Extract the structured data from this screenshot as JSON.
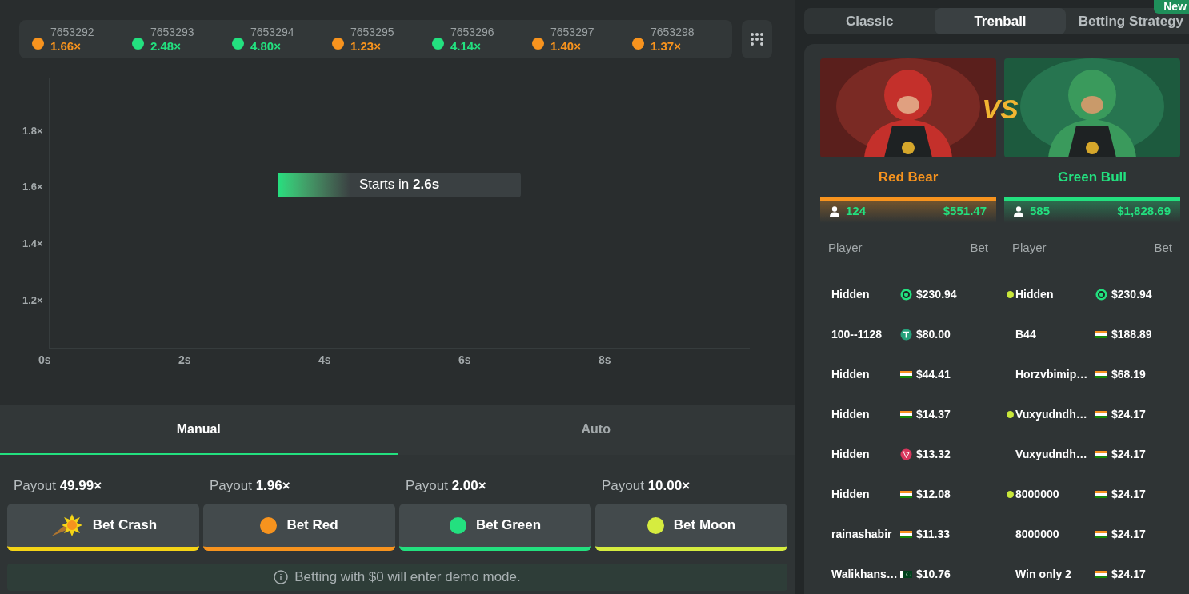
{
  "history": [
    {
      "id": "7653292",
      "multiplier": "1.66×",
      "color": "#f7931e"
    },
    {
      "id": "7653293",
      "multiplier": "2.48×",
      "color": "#23e07f"
    },
    {
      "id": "7653294",
      "multiplier": "4.80×",
      "color": "#23e07f"
    },
    {
      "id": "7653295",
      "multiplier": "1.23×",
      "color": "#f7931e"
    },
    {
      "id": "7653296",
      "multiplier": "4.14×",
      "color": "#23e07f"
    },
    {
      "id": "7653297",
      "multiplier": "1.40×",
      "color": "#f7931e"
    },
    {
      "id": "7653298",
      "multiplier": "1.37×",
      "color": "#f7931e"
    }
  ],
  "chart": {
    "y_ticks": [
      "1.8×",
      "1.6×",
      "1.4×",
      "1.2×"
    ],
    "x_ticks": [
      "0s",
      "2s",
      "4s",
      "6s",
      "8s"
    ],
    "countdown": {
      "text": "Starts in **2.6s**",
      "level": 0.3
    }
  },
  "bet_tabs": [
    {
      "label": "Manual",
      "selected": true
    },
    {
      "label": "Auto",
      "selected": false
    }
  ],
  "bets": [
    {
      "kind": "crash",
      "payout_label": "Payout",
      "payout": "49.99×",
      "label": "Bet Crash",
      "color": "#f5d416"
    },
    {
      "kind": "dot",
      "payout_label": "Payout",
      "payout": "1.96×",
      "label": "Bet Red",
      "color": "#f7931e"
    },
    {
      "kind": "dot",
      "payout_label": "Payout",
      "payout": "2.00×",
      "label": "Bet Green",
      "color": "#23e07f"
    },
    {
      "kind": "dot",
      "payout_label": "Payout",
      "payout": "10.00×",
      "label": "Bet Moon",
      "color": "#d6ec3f"
    }
  ],
  "notice": "Betting with $0 will enter demo mode.",
  "mode_tabs": [
    {
      "label": "Classic",
      "selected": false
    },
    {
      "label": "Trenball",
      "selected": true
    },
    {
      "label": "Betting Strategy",
      "selected": false,
      "badge": "New"
    }
  ],
  "vs": "VS",
  "sides": [
    {
      "name": "Red Bear",
      "color": "#f7931e",
      "players": "124",
      "total": "$551.47",
      "header_player": "Player",
      "header_bet": "Bet",
      "rows": [
        {
          "name": "Hidden",
          "kind": "bcd",
          "amount": "$230.94"
        },
        {
          "name": "100--1128",
          "kind": "tether",
          "amount": "$80.00"
        },
        {
          "name": "Hidden",
          "kind": "india",
          "amount": "$44.41"
        },
        {
          "name": "Hidden",
          "kind": "india",
          "amount": "$14.37"
        },
        {
          "name": "Hidden",
          "kind": "tron",
          "amount": "$13.32"
        },
        {
          "name": "Hidden",
          "kind": "india",
          "amount": "$12.08"
        },
        {
          "name": "rainashabir",
          "kind": "india",
          "amount": "$11.33"
        },
        {
          "name": "Walikhans…",
          "kind": "pakistan",
          "amount": "$10.76"
        }
      ]
    },
    {
      "name": "Green Bull",
      "color": "#23e07f",
      "players": "585",
      "total": "$1,828.69",
      "header_player": "Player",
      "header_bet": "Bet",
      "rows": [
        {
          "name": "Hidden",
          "dot": true,
          "kind": "bcd",
          "amount": "$230.94"
        },
        {
          "name": "B44",
          "dot": false,
          "kind": "india",
          "amount": "$188.89"
        },
        {
          "name": "Horzvbimip…",
          "dot": false,
          "kind": "india",
          "amount": "$68.19"
        },
        {
          "name": "Vuxyudndh…",
          "dot": true,
          "kind": "india",
          "amount": "$24.17"
        },
        {
          "name": "Vuxyudndh…",
          "dot": false,
          "kind": "india",
          "amount": "$24.17"
        },
        {
          "name": "8000000",
          "dot": true,
          "kind": "india",
          "amount": "$24.17"
        },
        {
          "name": "8000000",
          "dot": false,
          "kind": "india",
          "amount": "$24.17"
        },
        {
          "name": "Win only 2",
          "dot": false,
          "kind": "india",
          "amount": "$24.17"
        }
      ]
    }
  ]
}
